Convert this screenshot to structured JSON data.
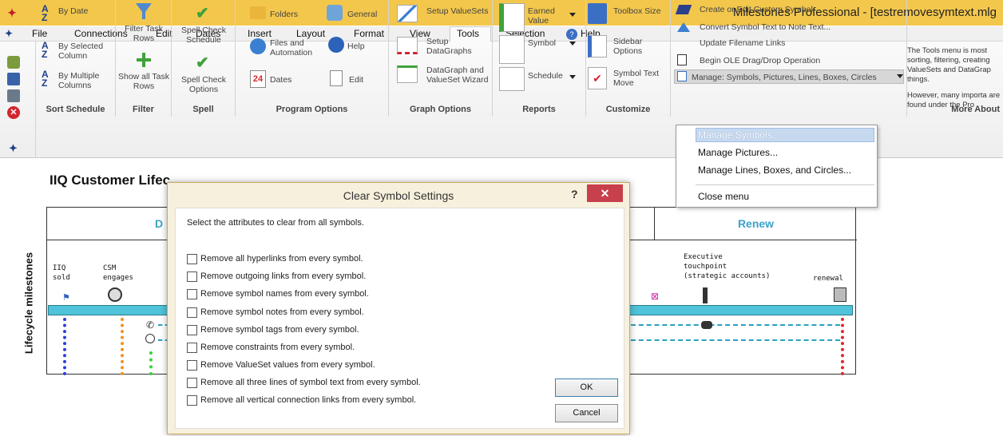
{
  "window": {
    "title": "Milestones Professional - [testremovesymtext.mlg"
  },
  "menu": [
    "File",
    "Connections",
    "Edit",
    "Dates",
    "Insert",
    "Layout",
    "Format",
    "View",
    "Tools",
    "Selection",
    "Help"
  ],
  "ribbon": {
    "sort": {
      "label": "Sort Schedule",
      "by_date": "By Date",
      "by_selected": "By Selected Column",
      "by_multiple": "By Multiple Columns"
    },
    "filter": {
      "label": "Filter",
      "filter_rows": "Filter Task Rows",
      "show_all": "Show all Task Rows"
    },
    "spell": {
      "label": "Spell",
      "check_schedule": "Spell Check Schedule",
      "check_options": "Spell Check Options"
    },
    "program_options": {
      "label": "Program Options",
      "folders": "Folders",
      "general": "General",
      "files": "Files and Automation",
      "help": "Help",
      "dates": "Dates",
      "edit": "Edit"
    },
    "graph_options": {
      "label": "Graph Options",
      "setup_valuesets": "Setup ValueSets",
      "setup_datagraphs": "Setup DataGraphs",
      "wizard": "DataGraph and ValueSet Wizard"
    },
    "reports": {
      "label": "Reports",
      "earned_value": "Earned Value",
      "symbol": "Symbol",
      "schedule": "Schedule"
    },
    "customize": {
      "label": "Customize",
      "toolbox_size": "Toolbox Size",
      "sidebar_options": "Sidebar Options",
      "symbol_text_move": "Symbol Text Move"
    },
    "commands": {
      "create_symbol": "Create or Edit Custom Symbol",
      "convert_text": "Convert Symbol Text to Note Text...",
      "update_links": "Update Filename Links",
      "ole_drag": "Begin OLE Drag/Drop Operation",
      "manage": "Manage: Symbols, Pictures, Lines, Boxes, Circles"
    },
    "more_about": {
      "label": "More About",
      "text1": "The Tools menu is most sorting, filtering, creating ValueSets and DataGrap things.",
      "text2": "However, many importa are found under the Pro"
    }
  },
  "popup_menu": [
    "Manage Symbols...",
    "Manage Pictures...",
    "Manage Lines, Boxes, and Circles...",
    "Close menu"
  ],
  "document": {
    "title": "IIQ Customer Lifec",
    "phase_left": "D",
    "phase_renew": "Renew",
    "row_label": "Lifecycle milestones",
    "milestones": {
      "iiq_sold": "IIQ\nsold",
      "csm": "CSM\nengages",
      "exec": "Executive\ntouchpoint\n(strategic accounts)",
      "renewal": "renewal"
    }
  },
  "dialog": {
    "title": "Clear Symbol Settings",
    "help": "?",
    "close": "✕",
    "instruction": "Select the attributes to clear from all symbols.",
    "options": [
      "Remove all hyperlinks from every symbol.",
      "Remove outgoing links from every symbol.",
      "Remove symbol names from every symbol.",
      "Remove symbol notes from every symbol.",
      "Remove symbol tags from every symbol.",
      "Remove constraints from every symbol.",
      "Remove ValueSet values from every symbol.",
      "Remove all three lines of symbol text from every symbol.",
      "Remove all vertical connection links from every symbol."
    ],
    "ok": "OK",
    "cancel": "Cancel"
  }
}
